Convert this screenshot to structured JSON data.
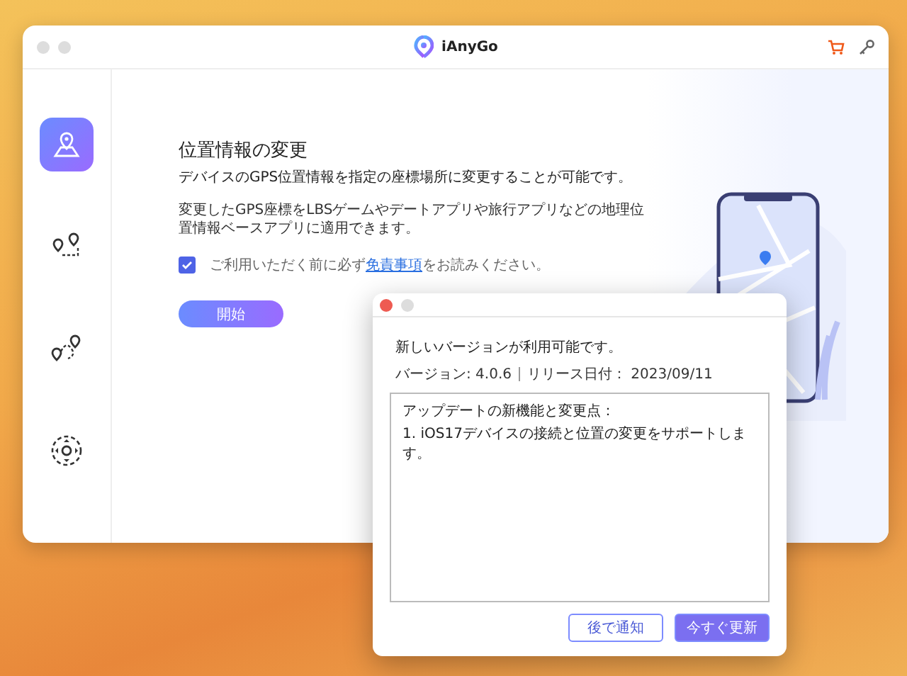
{
  "window": {
    "title": "iAnyGo"
  },
  "sidebar": {
    "items": [
      {
        "kind": "map-pin",
        "selected": true
      },
      {
        "kind": "two-spot",
        "selected": false
      },
      {
        "kind": "multi-spot",
        "selected": false
      },
      {
        "kind": "joystick",
        "selected": false
      }
    ]
  },
  "main": {
    "heading": "位置情報の変更",
    "subtitle": "デバイスのGPS位置情報を指定の座標場所に変更することが可能です。",
    "description": "変更したGPS座標をLBSゲームやデートアプリや旅行アプリなどの地理位置情報ベースアプリに適用できます。",
    "agreement": {
      "checked": true,
      "before": "ご利用いただく前に必ず",
      "link": "免責事項",
      "after": "をお読みください。"
    },
    "start_button": "開始"
  },
  "update_dialog": {
    "message": "新しいバージョンが利用可能です。",
    "version": "バージョン: 4.0.6",
    "release_date": "リリース日付： 2023/09/11",
    "notes": [
      "アップデートの新機能と変更点：",
      "1. iOS17デバイスの接続と位置の変更をサポートします。"
    ],
    "buttons": [
      {
        "label": "後で通知",
        "kind": "secondary"
      },
      {
        "label": "今すぐ更新",
        "kind": "primary"
      }
    ]
  }
}
